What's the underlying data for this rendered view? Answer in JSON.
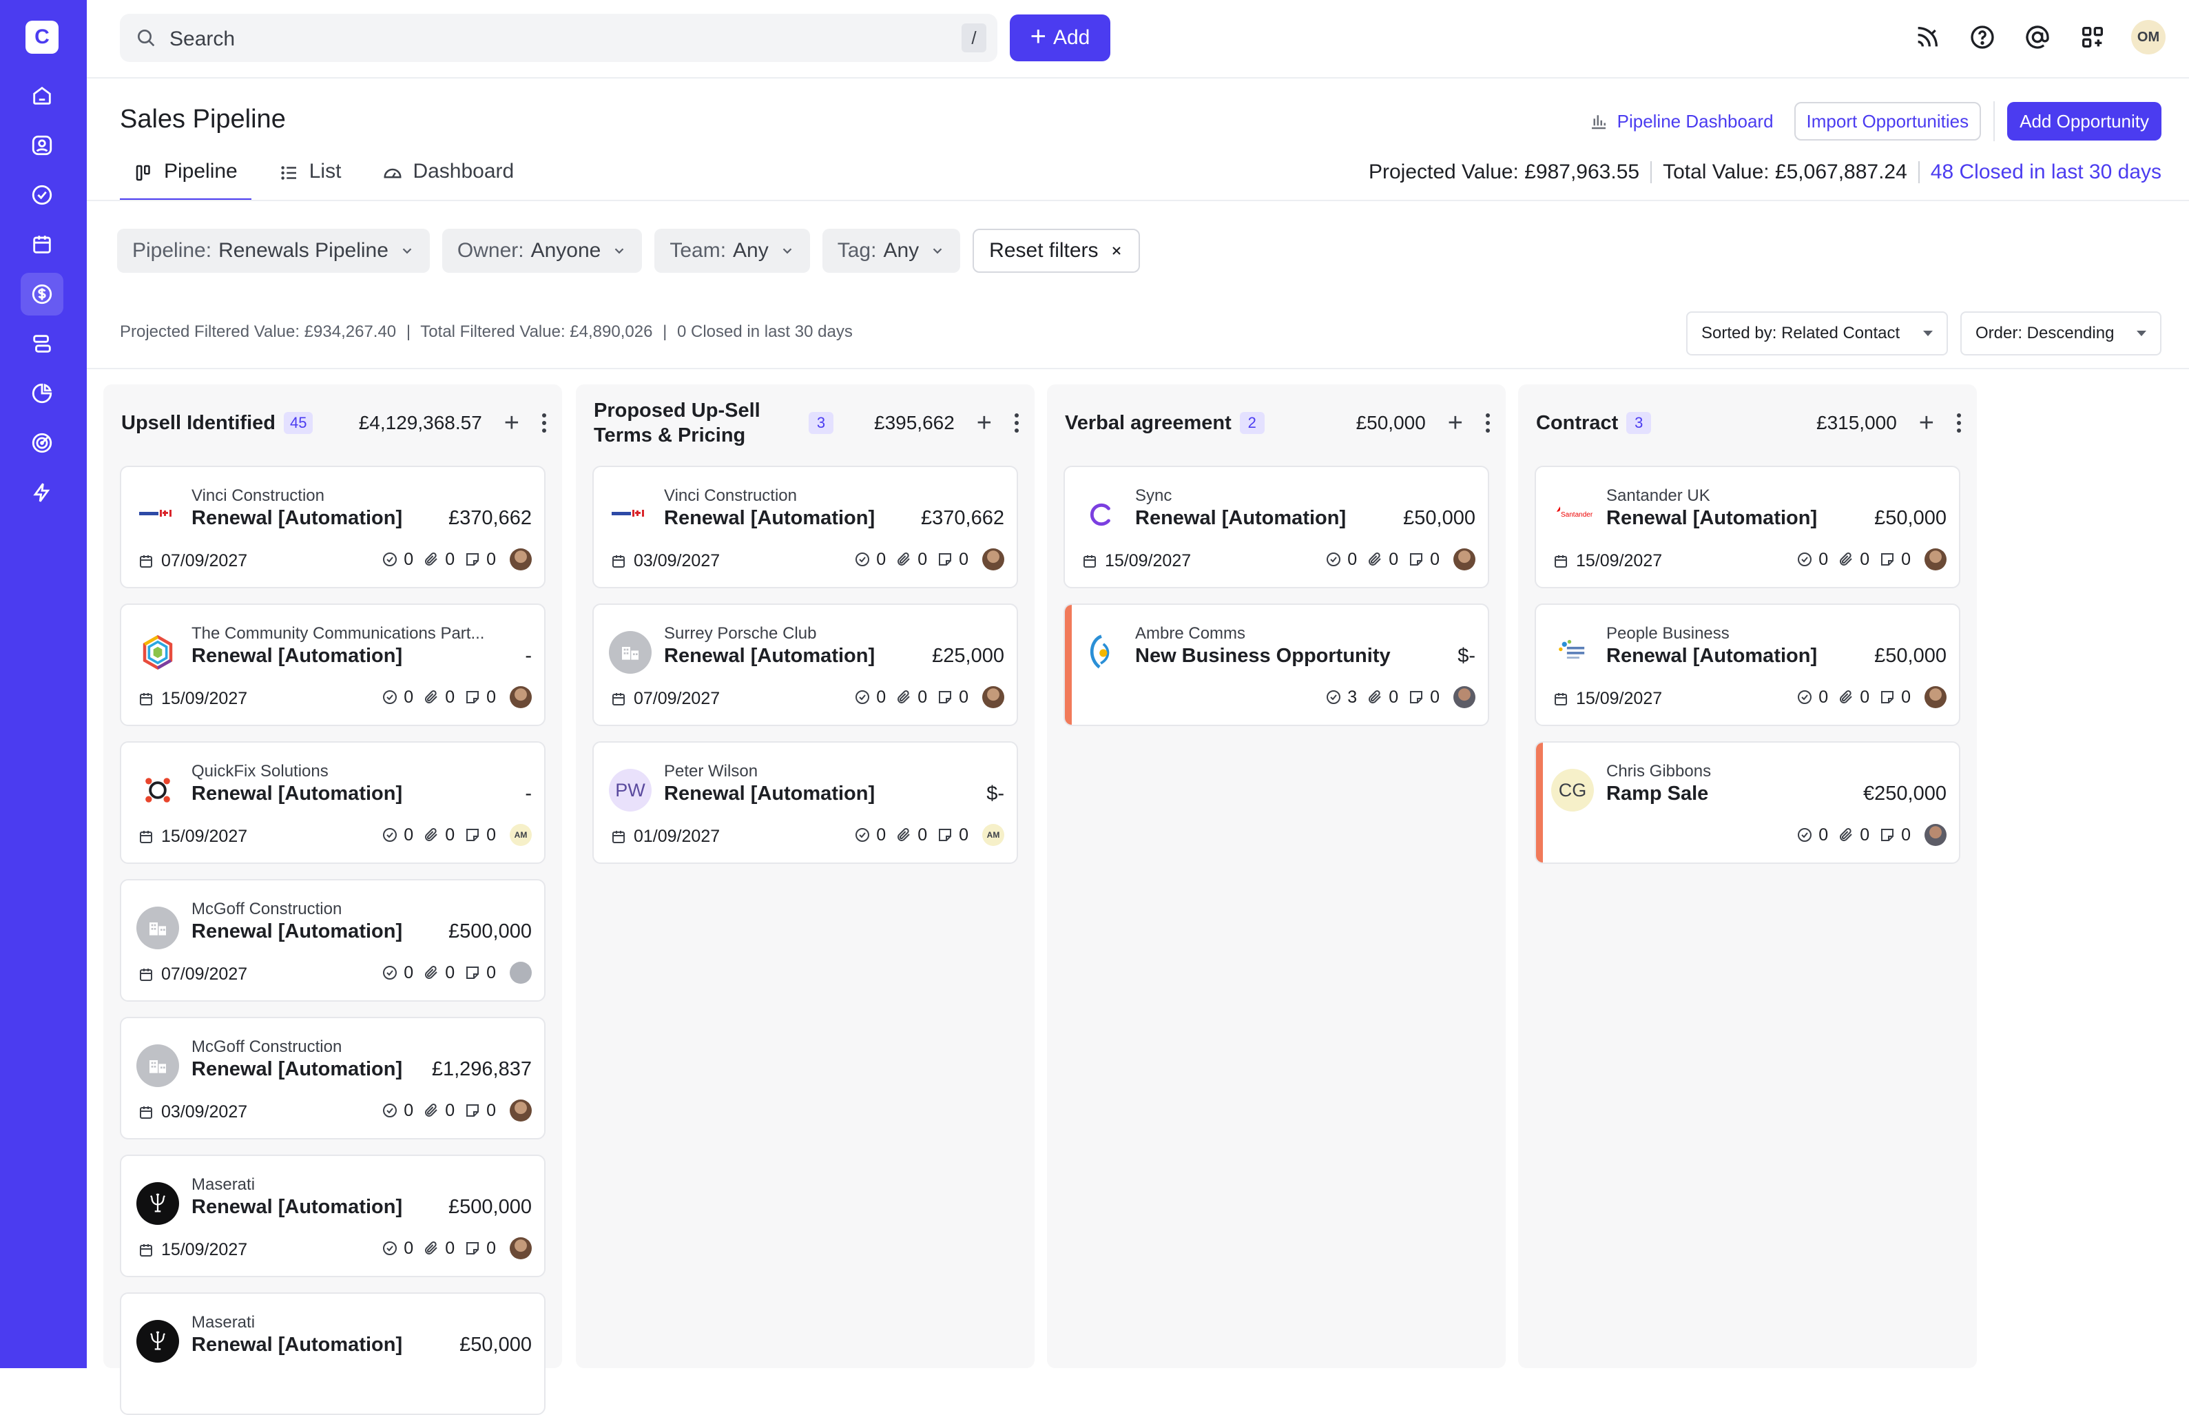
{
  "app": {
    "logo_letter": "C"
  },
  "search": {
    "placeholder": "Search",
    "shortcut": "/"
  },
  "topbar": {
    "add_label": "Add",
    "avatar_initials": "OM"
  },
  "page": {
    "title": "Sales Pipeline",
    "actions": {
      "dashboard": "Pipeline Dashboard",
      "import": "Import Opportunities",
      "add": "Add Opportunity"
    },
    "tabs": [
      {
        "label": "Pipeline"
      },
      {
        "label": "List"
      },
      {
        "label": "Dashboard"
      }
    ],
    "totals": {
      "projected": "Projected Value: £987,963.55",
      "total": "Total Value: £5,067,887.24",
      "closed": "48 Closed in last 30 days"
    }
  },
  "filters": {
    "pipeline": {
      "label": "Pipeline:",
      "value": "Renewals Pipeline"
    },
    "owner": {
      "label": "Owner:",
      "value": "Anyone"
    },
    "team": {
      "label": "Team:",
      "value": "Any"
    },
    "tag": {
      "label": "Tag:",
      "value": "Any"
    },
    "reset": "Reset filters"
  },
  "summary": {
    "projected_filtered": "Projected Filtered Value: £934,267.40",
    "total_filtered": "Total Filtered Value: £4,890,026",
    "closed_filtered": "0 Closed in last 30 days",
    "separator": "|"
  },
  "sort": {
    "sorted_by": "Sorted by: Related Contact",
    "order": "Order: Descending"
  },
  "columns": [
    {
      "title": "Upsell Identified",
      "count": "45",
      "total": "£4,129,368.57",
      "cards": [
        {
          "company": "Vinci Construction",
          "deal": "Renewal [Automation]",
          "amount": "£370,662",
          "date": "07/09/2027",
          "tasks": "0",
          "files": "0",
          "notes": "0"
        },
        {
          "company": "The Community Communications Part...",
          "deal": "Renewal [Automation]",
          "amount": "-",
          "date": "15/09/2027",
          "tasks": "0",
          "files": "0",
          "notes": "0"
        },
        {
          "company": "QuickFix Solutions",
          "deal": "Renewal [Automation]",
          "amount": "-",
          "date": "15/09/2027",
          "tasks": "0",
          "files": "0",
          "notes": "0",
          "owner": "AM"
        },
        {
          "company": "McGoff Construction",
          "deal": "Renewal [Automation]",
          "amount": "£500,000",
          "date": "07/09/2027",
          "tasks": "0",
          "files": "0",
          "notes": "0"
        },
        {
          "company": "McGoff Construction",
          "deal": "Renewal [Automation]",
          "amount": "£1,296,837",
          "date": "03/09/2027",
          "tasks": "0",
          "files": "0",
          "notes": "0"
        },
        {
          "company": "Maserati",
          "deal": "Renewal [Automation]",
          "amount": "£500,000",
          "date": "15/09/2027",
          "tasks": "0",
          "files": "0",
          "notes": "0"
        },
        {
          "company": "Maserati",
          "deal": "Renewal [Automation]",
          "amount": "£50,000",
          "date": "",
          "tasks": "",
          "files": "",
          "notes": ""
        }
      ]
    },
    {
      "title": "Proposed Up-Sell Terms & Pricing",
      "count": "3",
      "total": "£395,662",
      "cards": [
        {
          "company": "Vinci Construction",
          "deal": "Renewal [Automation]",
          "amount": "£370,662",
          "date": "03/09/2027",
          "tasks": "0",
          "files": "0",
          "notes": "0"
        },
        {
          "company": "Surrey Porsche Club",
          "deal": "Renewal [Automation]",
          "amount": "£25,000",
          "date": "07/09/2027",
          "tasks": "0",
          "files": "0",
          "notes": "0"
        },
        {
          "company": "Peter Wilson",
          "initials": "PW",
          "deal": "Renewal [Automation]",
          "amount": "$-",
          "date": "01/09/2027",
          "tasks": "0",
          "files": "0",
          "notes": "0",
          "owner": "AM"
        }
      ]
    },
    {
      "title": "Verbal agreement",
      "count": "2",
      "total": "£50,000",
      "cards": [
        {
          "company": "Sync",
          "deal": "Renewal [Automation]",
          "amount": "£50,000",
          "date": "15/09/2027",
          "tasks": "0",
          "files": "0",
          "notes": "0"
        },
        {
          "company": "Ambre Comms",
          "deal": "New Business Opportunity",
          "amount": "$-",
          "date": "",
          "tasks": "3",
          "files": "0",
          "notes": "0"
        }
      ]
    },
    {
      "title": "Contract",
      "count": "3",
      "total": "£315,000",
      "cards": [
        {
          "company": "Santander UK",
          "logo_text": "Santander",
          "deal": "Renewal [Automation]",
          "amount": "£50,000",
          "date": "15/09/2027",
          "tasks": "0",
          "files": "0",
          "notes": "0"
        },
        {
          "company": "People Business",
          "deal": "Renewal [Automation]",
          "amount": "£50,000",
          "date": "15/09/2027",
          "tasks": "0",
          "files": "0",
          "notes": "0"
        },
        {
          "company": "Chris Gibbons",
          "initials": "CG",
          "deal": "Ramp Sale",
          "amount": "€250,000",
          "date": "",
          "tasks": "0",
          "files": "0",
          "notes": "0"
        }
      ]
    }
  ]
}
